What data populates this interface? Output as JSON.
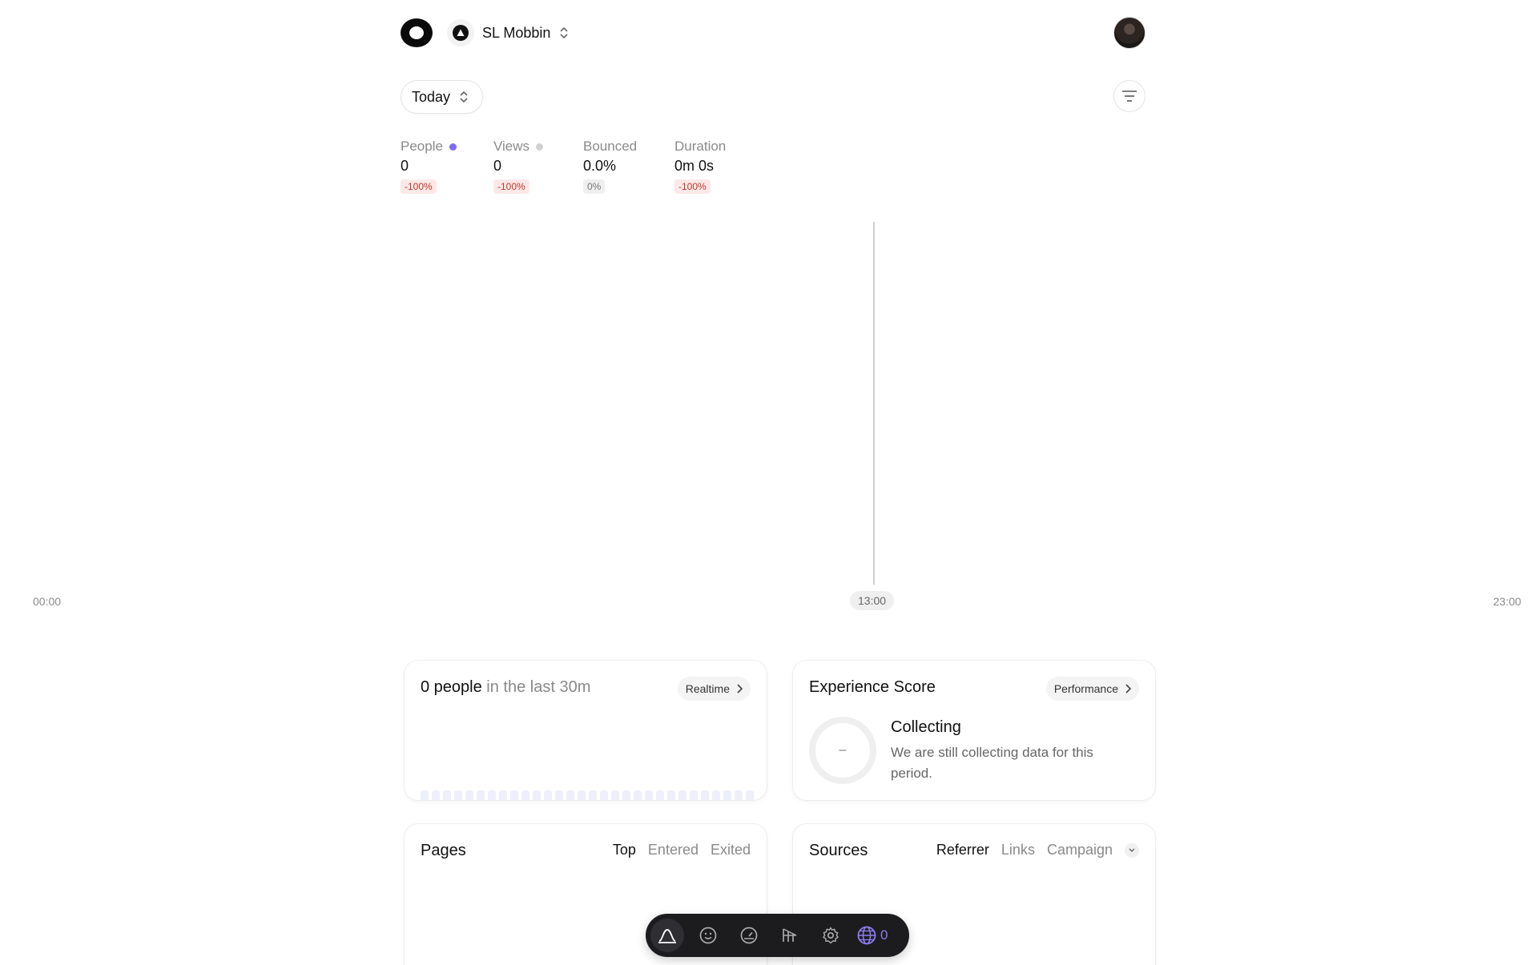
{
  "header": {
    "site_name": "SL Mobbin"
  },
  "toolbar": {
    "date_range": "Today"
  },
  "metrics": [
    {
      "label": "People",
      "value": "0",
      "delta": "-100%",
      "dot_color": "#7b6ef6",
      "delta_type": "negative"
    },
    {
      "label": "Views",
      "value": "0",
      "delta": "-100%",
      "dot_color": "#d0d0d0",
      "delta_type": "negative"
    },
    {
      "label": "Bounced",
      "value": "0.0%",
      "delta": "0%",
      "dot_color": "",
      "delta_type": "neutral"
    },
    {
      "label": "Duration",
      "value": "0m 0s",
      "delta": "-100%",
      "dot_color": "",
      "delta_type": "negative"
    }
  ],
  "chart": {
    "x_start": "00:00",
    "x_now": "13:00",
    "x_end": "23:00",
    "line_color": "#7b6ef6"
  },
  "realtime": {
    "count_text": "0 people",
    "suffix_text": " in the last 30m",
    "button_label": "Realtime",
    "bar_count": 30
  },
  "experience": {
    "title": "Experience Score",
    "button_label": "Performance",
    "score": "–",
    "status": "Collecting",
    "description": "We are still collecting data for this period."
  },
  "pages": {
    "title": "Pages",
    "tabs": [
      "Top",
      "Entered",
      "Exited"
    ],
    "active_tab": "Top"
  },
  "sources": {
    "title": "Sources",
    "tabs": [
      "Referrer",
      "Links",
      "Campaign"
    ],
    "active_tab": "Referrer"
  },
  "dock": {
    "items": [
      "dashboard-icon",
      "smiley-icon",
      "gauge-icon",
      "funnel-icon",
      "gear-icon"
    ],
    "live_count": "0",
    "accent": "#8c7cf0"
  }
}
